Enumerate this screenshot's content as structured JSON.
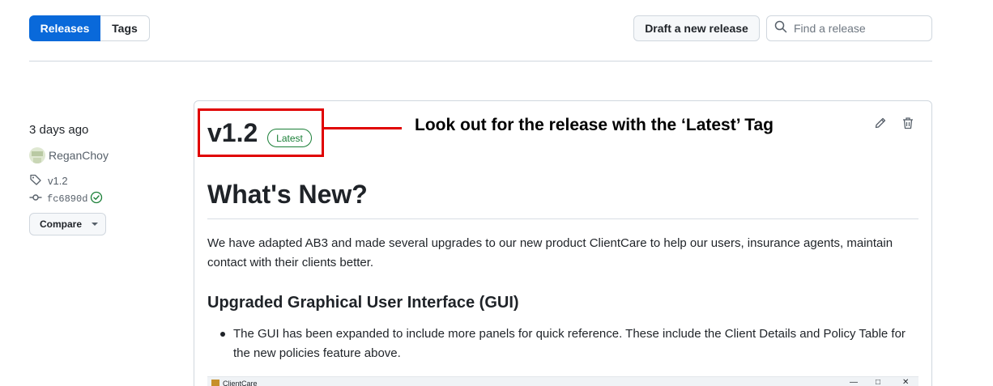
{
  "toolbar": {
    "tabs": [
      {
        "label": "Releases",
        "active": true
      },
      {
        "label": "Tags",
        "active": false
      }
    ],
    "draft_button": "Draft a new release",
    "search_placeholder": "Find a release"
  },
  "release_meta": {
    "date": "3 days ago",
    "author": "ReganChoy",
    "tag": "v1.2",
    "commit": "fc6890d",
    "compare_button": "Compare"
  },
  "release": {
    "version": "v1.2",
    "badge": "Latest",
    "heading": "What's New?",
    "intro": "We have adapted AB3 and made several upgrades to our new product ClientCare to help our users, insurance agents, maintain contact with their clients better.",
    "section_title": "Upgraded Graphical User Interface (GUI)",
    "bullets": [
      "The GUI has been expanded to include more panels for quick reference. These include the Client Details and Policy Table for the new policies feature above."
    ],
    "embedded_window_title": "ClientCare"
  },
  "annotation": {
    "text": "Look out for the release with the ‘Latest’ Tag"
  },
  "colors": {
    "accent": "#0969da",
    "latest_green": "#1a7f37",
    "annotation_red": "#e00000"
  }
}
